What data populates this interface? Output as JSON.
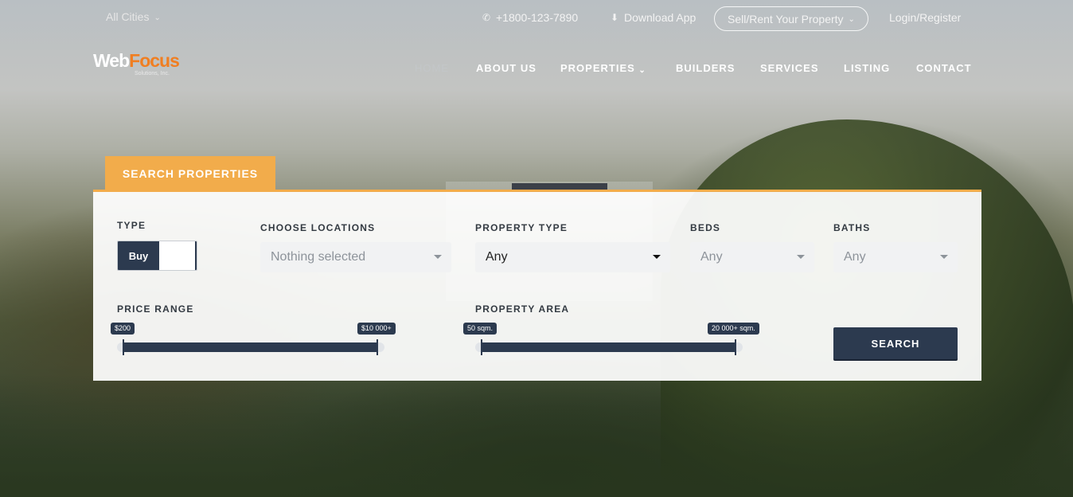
{
  "topbar": {
    "cities_label": "All Cities",
    "phone": "+1800-123-7890",
    "download_label": "Download App",
    "sell_label": "Sell/Rent Your Property",
    "login_label": "Login/Register"
  },
  "logo": {
    "word_a": "Web",
    "word_b": "Focus",
    "tagline": "Solutions, Inc."
  },
  "nav": {
    "items": [
      "HOME",
      "ABOUT US",
      "PROPERTIES",
      "BUILDERS",
      "SERVICES",
      "LISTING",
      "CONTACT"
    ],
    "active": "HOME"
  },
  "search": {
    "tab_label": "SEARCH PROPERTIES",
    "type_label": "TYPE",
    "type_value": "Buy",
    "locations_label": "CHOOSE LOCATIONS",
    "locations_value": "Nothing selected",
    "property_type_label": "PROPERTY TYPE",
    "property_type_value": "Any",
    "beds_label": "BEDS",
    "beds_value": "Any",
    "baths_label": "BATHS",
    "baths_value": "Any",
    "price_label": "PRICE RANGE",
    "price_min": "$200",
    "price_max": "$10 000+",
    "area_label": "PROPERTY AREA",
    "area_min": "50 sqm.",
    "area_max": "20 000+ sqm.",
    "button_label": "SEARCH"
  },
  "colors": {
    "accent": "#f2ac4b",
    "dark": "#2c3a4f",
    "logo_orange": "#f07e21"
  }
}
